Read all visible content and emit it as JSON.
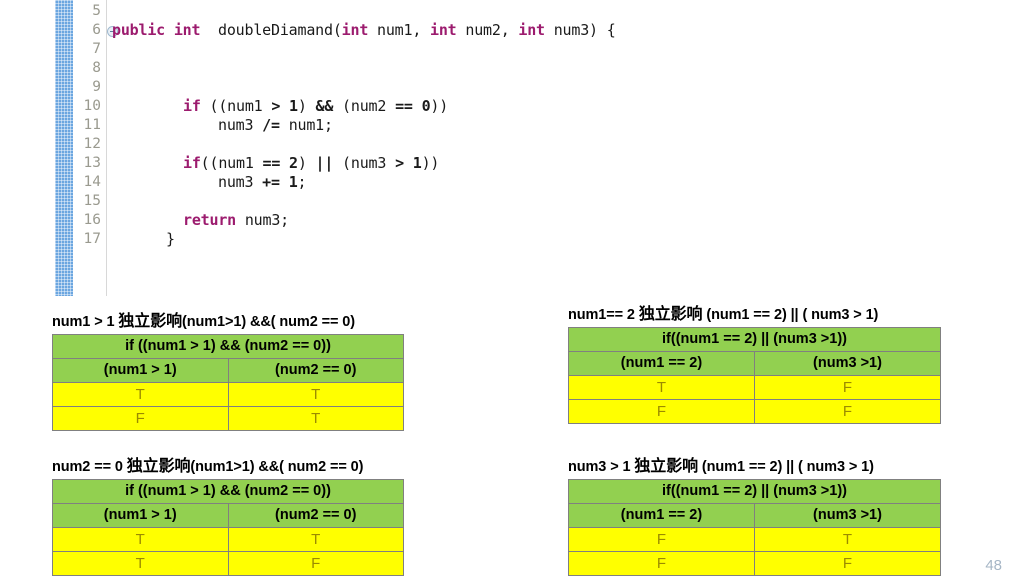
{
  "editor": {
    "line_numbers": [
      "5",
      "6",
      "7",
      "8",
      "9",
      "10",
      "11",
      "12",
      "13",
      "14",
      "15",
      "16",
      "17"
    ],
    "fold_marker_line": "6",
    "lines": [
      {
        "num": "5",
        "text": ""
      },
      {
        "num": "6",
        "text": "public int  doubleDiamand(int num1, int num2, int num3) {"
      },
      {
        "num": "7",
        "text": ""
      },
      {
        "num": "8",
        "text": ""
      },
      {
        "num": "9",
        "text": "if ((num1 > 1) && (num2 == 0))"
      },
      {
        "num": "10",
        "text": "num3 /= num1;"
      },
      {
        "num": "11",
        "text": ""
      },
      {
        "num": "12",
        "text": "if((num1 == 2) || (num3 > 1))"
      },
      {
        "num": "13",
        "text": "num3 += 1;"
      },
      {
        "num": "14",
        "text": ""
      },
      {
        "num": "15",
        "text": "return num3;"
      },
      {
        "num": "16",
        "text": "}"
      },
      {
        "num": "17",
        "text": ""
      }
    ]
  },
  "colors": {
    "keyword": "#9c1b6e",
    "header_green": "#92d050",
    "value_yellow": "#ffff00",
    "value_text": "#9b8b00",
    "marker_blue": "#6ba6e0",
    "page_number": "#a6b6c6"
  },
  "tables": [
    {
      "id": "top-left",
      "caption_prefix": "num1 > 1 ",
      "caption_cjk": "独立影响",
      "caption_suffix": "(num1>1) &&( num2 == 0)",
      "condition_header": "if ((num1 > 1) && (num2 == 0))",
      "columns": [
        "(num1 > 1)",
        "(num2 == 0)"
      ],
      "rows": [
        [
          "T",
          "T"
        ],
        [
          "F",
          "T"
        ]
      ]
    },
    {
      "id": "top-right",
      "caption_prefix": "num1== 2 ",
      "caption_cjk": "独立影响",
      "caption_suffix": " (num1 == 2) || ( num3 > 1)",
      "condition_header": "if((num1 == 2) || (num3 >1))",
      "columns": [
        "(num1 == 2)",
        "(num3 >1)"
      ],
      "rows": [
        [
          "T",
          "F"
        ],
        [
          "F",
          "F"
        ]
      ]
    },
    {
      "id": "bottom-left",
      "caption_prefix": "num2 == 0 ",
      "caption_cjk": "独立影响",
      "caption_suffix": "(num1>1) &&( num2 == 0)",
      "condition_header": "if ((num1 > 1) && (num2 == 0))",
      "columns": [
        "(num1 > 1)",
        "(num2 == 0)"
      ],
      "rows": [
        [
          "T",
          "T"
        ],
        [
          "T",
          "F"
        ]
      ]
    },
    {
      "id": "bottom-right",
      "caption_prefix": "num3 > 1 ",
      "caption_cjk": "独立影响",
      "caption_suffix": " (num1 == 2) || ( num3 > 1)",
      "condition_header": "if((num1 == 2) || (num3 >1))",
      "columns": [
        "(num1 == 2)",
        "(num3 >1)"
      ],
      "rows": [
        [
          "F",
          "T"
        ],
        [
          "F",
          "F"
        ]
      ]
    }
  ],
  "page_number": "48"
}
